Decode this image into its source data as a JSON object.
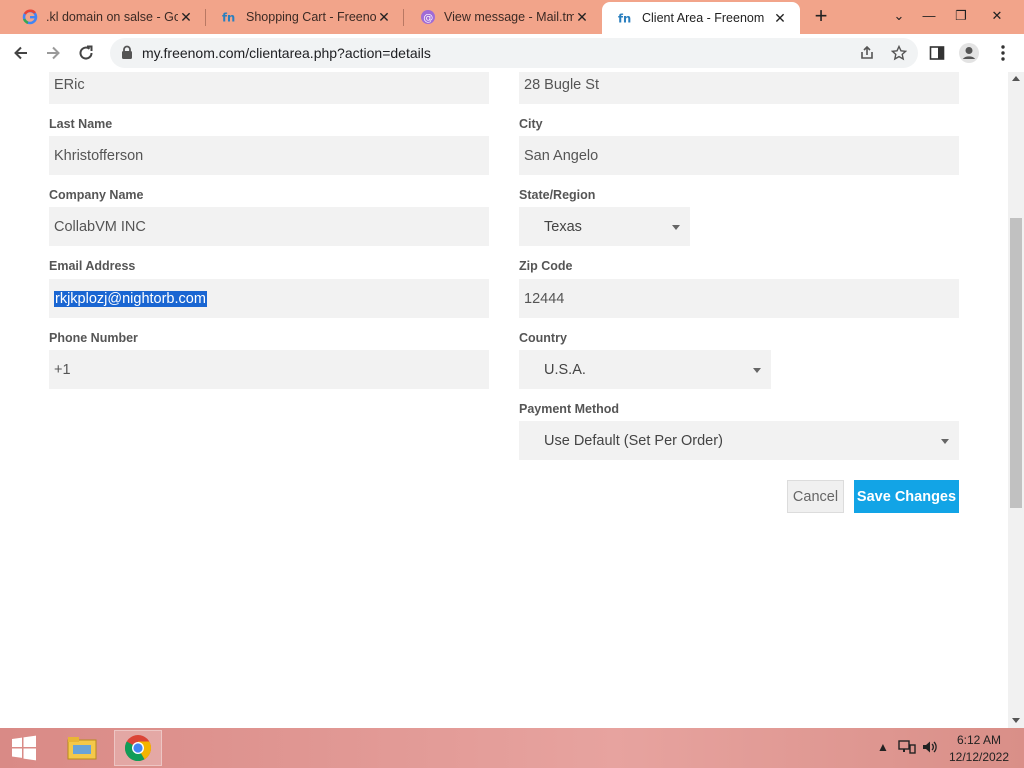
{
  "tabs": [
    {
      "title": ".kl domain on salse - Goo",
      "icon": "google-icon"
    },
    {
      "title": "Shopping Cart - Freenom",
      "icon": "freenom-icon"
    },
    {
      "title": "View message - Mail.tm",
      "icon": "mail-tm-icon"
    },
    {
      "title": "Client Area - Freenom",
      "icon": "freenom-icon",
      "active": true
    }
  ],
  "toolbar": {
    "url": "my.freenom.com/clientarea.php?action=details"
  },
  "form": {
    "first_name_value": "ERic",
    "last_name_label": "Last Name",
    "last_name_value": "Khristofferson",
    "company_label": "Company Name",
    "company_value": "CollabVM INC",
    "email_label": "Email Address",
    "email_value": "rkjkplozj@nightorb.com",
    "phone_label": "Phone Number",
    "phone_value": "+1",
    "address_value": "28 Bugle St",
    "city_label": "City",
    "city_value": "San Angelo",
    "state_label": "State/Region",
    "state_value": "Texas",
    "zip_label": "Zip Code",
    "zip_value": "12444",
    "country_label": "Country",
    "country_value": "U.S.A.",
    "payment_label": "Payment Method",
    "payment_value": "Use Default (Set Per Order)",
    "cancel_label": "Cancel",
    "save_label": "Save Changes"
  },
  "colors": {
    "tabstrip": "#f2a48a",
    "save_button": "#12a4e6",
    "field_bg": "#f2f2f2",
    "selection": "#1a66d2"
  },
  "taskbar": {
    "time": "6:12 AM",
    "date": "12/12/2022"
  }
}
